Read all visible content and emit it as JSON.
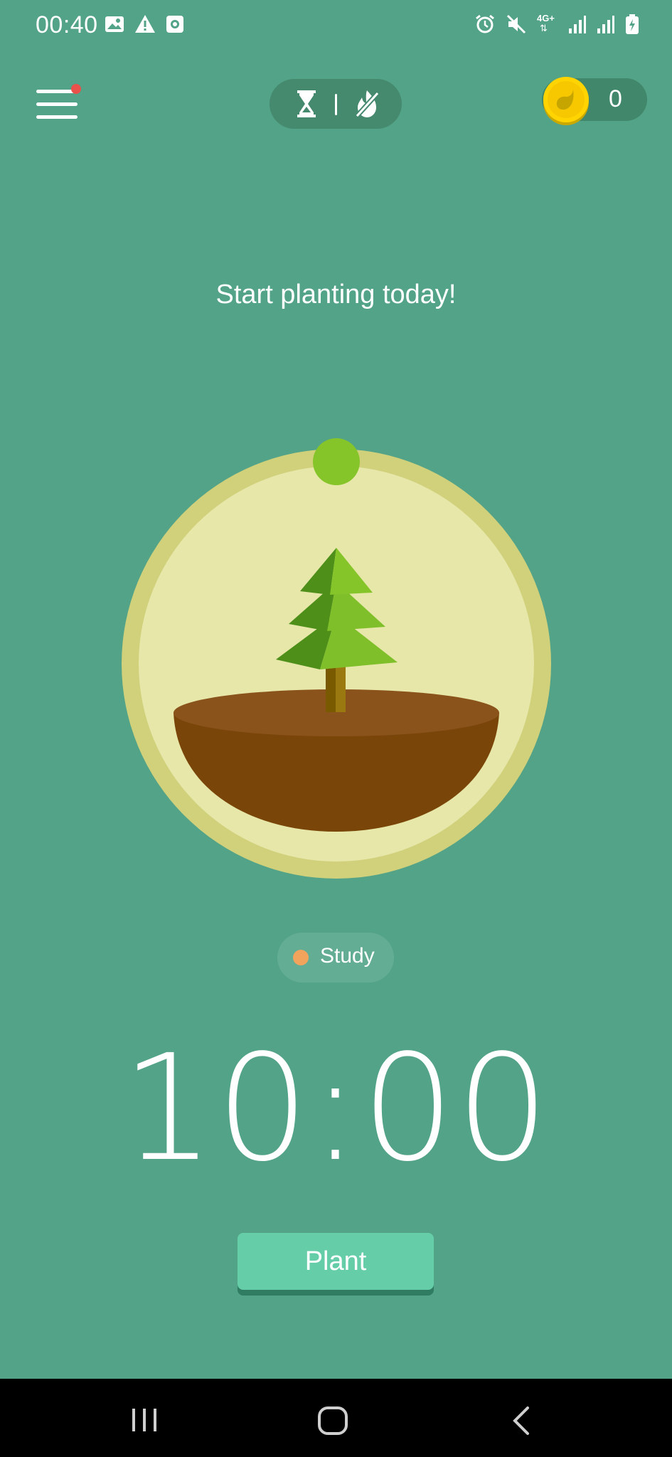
{
  "status_bar": {
    "time": "00:40",
    "network_label": "4G+",
    "left_icons": [
      "image-icon",
      "warning-icon",
      "app-notification-icon"
    ],
    "right_icons": [
      "alarm-icon",
      "mute-icon",
      "signal-icon",
      "signal-icon",
      "battery-charging-icon"
    ]
  },
  "header": {
    "menu_icon": "hamburger-menu-icon",
    "has_notification": true,
    "notification_color": "#e8524a",
    "mode_toggle": {
      "timer_mode_icon": "hourglass-icon",
      "deep_focus_icon": "no-fire-icon"
    },
    "coins": {
      "icon": "coin-icon",
      "count": "0"
    }
  },
  "main": {
    "headline": "Start planting today!",
    "tree_illustration": "pine-tree-icon",
    "tag": {
      "label": "Study",
      "color": "#f2a45c"
    },
    "timer": "10:00",
    "plant_button": "Plant"
  },
  "colors": {
    "background": "#52a387",
    "button": "#66cda9",
    "ring_outer": "#d1d07b",
    "ring_inner": "#e6e7a8",
    "slider_knob": "#86c52a",
    "soil": "#7a4509"
  },
  "nav_bar": {
    "recent_icon": "recent-apps-icon",
    "home_icon": "home-icon",
    "back_icon": "back-icon"
  }
}
